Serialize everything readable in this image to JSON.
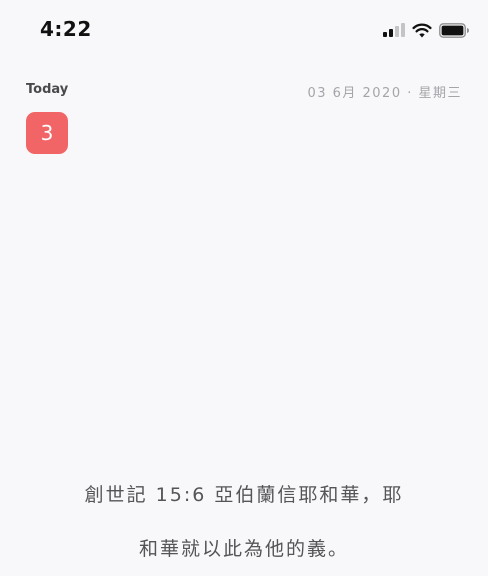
{
  "status_bar": {
    "time": "4:22",
    "icons": [
      "cellular-signal-icon",
      "wifi-icon",
      "battery-icon"
    ]
  },
  "header": {
    "today_label": "Today",
    "date_text": "03 6月 2020 · 星期三"
  },
  "day_badge": {
    "value": "3",
    "color": "#f26566"
  },
  "verse": {
    "text": "創世記 15:6 亞伯蘭信耶和華，耶\n和華就以此為他的義。"
  },
  "colors": {
    "background": "#f8f8fa",
    "accent": "#f26566",
    "muted_text": "#a5a5a9"
  }
}
